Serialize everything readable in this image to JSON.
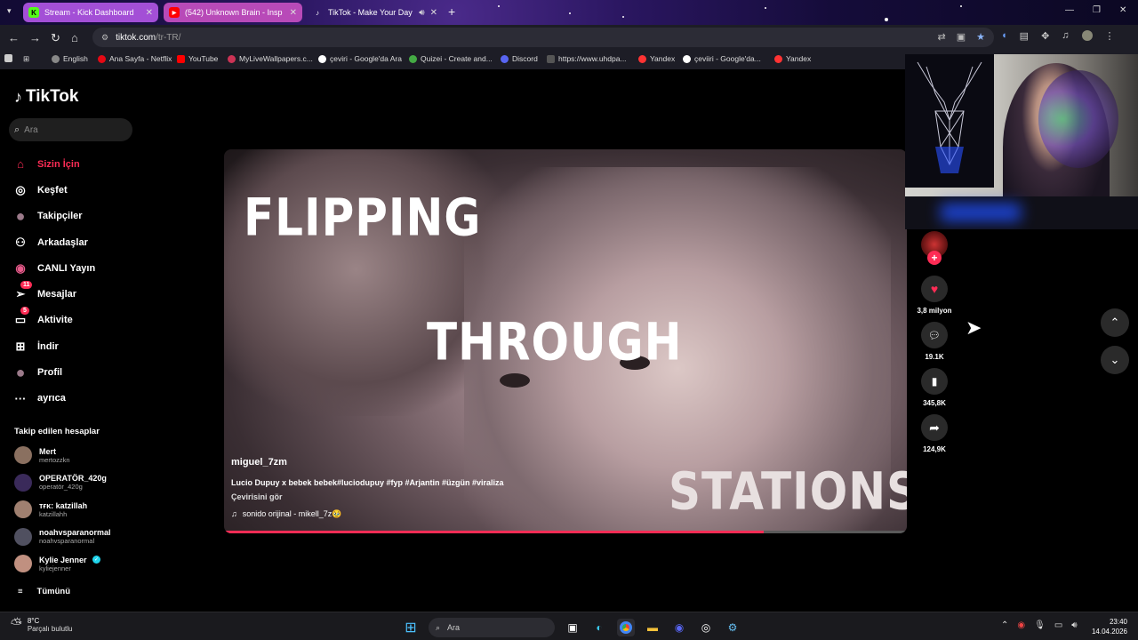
{
  "browser": {
    "tabs": [
      {
        "title": "Stream - Kick Dashboard",
        "icon": "K",
        "icon_color": "#53fc18"
      },
      {
        "title": "(542) Unknown Brain - Insp",
        "icon": "▶",
        "icon_color": "#ff0000"
      },
      {
        "title": "TikTok - Make Your Day",
        "icon": "♪",
        "icon_color": "#000000"
      }
    ],
    "url_domain": "tiktok.com",
    "url_path": "/tr-TR/",
    "bookmarks": [
      {
        "label": "English",
        "color": "#888888"
      },
      {
        "label": "Ana Sayfa - Netflix",
        "color": "#e50914"
      },
      {
        "label": "YouTube",
        "color": "#ff0000"
      },
      {
        "label": "MyLiveWallpapers.c...",
        "color": "#cc3355"
      },
      {
        "label": "çeviri - Google'da Ara",
        "color": "#ffffff"
      },
      {
        "label": "Quizei - Create and...",
        "color": "#44aa44"
      },
      {
        "label": "Discord",
        "color": "#5865f2"
      },
      {
        "label": "https://www.uhdpa...",
        "color": "#333333"
      },
      {
        "label": "Yandex",
        "color": "#ff3333"
      },
      {
        "label": "çeviiri - Google'da...",
        "color": "#ffffff"
      },
      {
        "label": "Yandex",
        "color": "#ff3333"
      }
    ]
  },
  "tiktok": {
    "logo": "TikTok",
    "search_placeholder": "Ara",
    "nav": [
      {
        "label": "Sizin İçin",
        "icon": "home-icon",
        "glyph": "⌂",
        "active": true,
        "badge": ""
      },
      {
        "label": "Keşfet",
        "icon": "compass-icon",
        "glyph": "◎",
        "active": false,
        "badge": ""
      },
      {
        "label": "Takipçiler",
        "icon": "followers-avatar-icon",
        "glyph": "●",
        "active": false,
        "badge": ""
      },
      {
        "label": "Arkadaşlar",
        "icon": "friends-icon",
        "glyph": "⚇",
        "active": false,
        "badge": ""
      },
      {
        "label": "CANLI Yayın",
        "icon": "live-icon",
        "glyph": "◉",
        "active": false,
        "badge": ""
      },
      {
        "label": "Mesajlar",
        "icon": "send-icon",
        "glyph": "➢",
        "active": false,
        "badge": "11"
      },
      {
        "label": "Aktivite",
        "icon": "activity-icon",
        "glyph": "▭",
        "active": false,
        "badge": "5"
      },
      {
        "label": "İndir",
        "icon": "download-icon",
        "glyph": "⊞",
        "active": false,
        "badge": ""
      },
      {
        "label": "Profil",
        "icon": "profile-avatar-icon",
        "glyph": "●",
        "active": false,
        "badge": ""
      },
      {
        "label": "ayrıca",
        "icon": "more-icon",
        "glyph": "···",
        "active": false,
        "badge": ""
      }
    ],
    "following_title": "Takip edilen hesaplar",
    "following": [
      {
        "name": "Mert",
        "handle": "mertozzkn",
        "color": "#8a7060"
      },
      {
        "name": "OPERATÖR_420g",
        "handle": "operatör_420g",
        "color": "#3a2a5a"
      },
      {
        "name": "ᴛғᴋ: katzillah",
        "handle": "katzillahh",
        "color": "#a08070"
      },
      {
        "name": "noahvsparanormal",
        "handle": "noahvsparanormal",
        "color": "#505060"
      },
      {
        "name": "Kylie Jenner",
        "handle": "kyliejenner",
        "color": "#c09080"
      }
    ],
    "see_all": "Tümünü",
    "video": {
      "overlay": [
        "FLIPPING",
        "THROUGH",
        "STATIONS"
      ],
      "author": "miguel_7zm",
      "caption": "Lucio Dupuy x bebek bebek#luciodupuy #fyp #Arjantin #üzgün #viraliza",
      "translate": "Çevirisini gör",
      "music": "sonido orijinal - mikell_7z🥹",
      "progress": 0.79
    },
    "actions": {
      "likes": "3,8 milyon",
      "comments": "19.1K",
      "saves": "345,8K",
      "shares": "124,9K"
    }
  },
  "taskbar": {
    "temp": "8°C",
    "weather": "Parçalı bulutlu",
    "search": "Ara",
    "time": "23:40",
    "date": "14.04.2026"
  }
}
